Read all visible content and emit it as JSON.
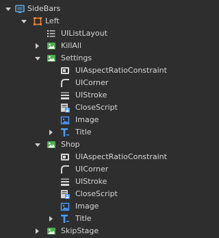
{
  "explorer": {
    "items": [
      {
        "label": "SideBars",
        "icon": "screen-gui-icon",
        "arrow": "expanded"
      },
      {
        "label": "Left",
        "icon": "frame-icon",
        "arrow": "expanded"
      },
      {
        "label": "UIListLayout",
        "icon": "list-layout-icon",
        "arrow": "none"
      },
      {
        "label": "KillAll",
        "icon": "image-button-icon",
        "arrow": "collapsed"
      },
      {
        "label": "Settings",
        "icon": "image-button-icon",
        "arrow": "expanded"
      },
      {
        "label": "UIAspectRatioConstraint",
        "icon": "aspect-ratio-icon",
        "arrow": "none"
      },
      {
        "label": "UICorner",
        "icon": "corner-icon",
        "arrow": "none"
      },
      {
        "label": "UIStroke",
        "icon": "stroke-icon",
        "arrow": "none"
      },
      {
        "label": "CloseScript",
        "icon": "local-script-icon",
        "arrow": "none"
      },
      {
        "label": "Image",
        "icon": "image-label-icon",
        "arrow": "none"
      },
      {
        "label": "Title",
        "icon": "text-label-icon",
        "arrow": "collapsed"
      },
      {
        "label": "Shop",
        "icon": "image-button-icon",
        "arrow": "expanded"
      },
      {
        "label": "UIAspectRatioConstraint",
        "icon": "aspect-ratio-icon",
        "arrow": "none"
      },
      {
        "label": "UICorner",
        "icon": "corner-icon",
        "arrow": "none"
      },
      {
        "label": "UIStroke",
        "icon": "stroke-icon",
        "arrow": "none"
      },
      {
        "label": "CloseScript",
        "icon": "local-script-icon",
        "arrow": "none"
      },
      {
        "label": "Image",
        "icon": "image-label-icon",
        "arrow": "none"
      },
      {
        "label": "Title",
        "icon": "text-label-icon",
        "arrow": "collapsed"
      },
      {
        "label": "SkipStage",
        "icon": "image-button-icon",
        "arrow": "collapsed"
      }
    ]
  },
  "colors": {
    "background": "#2e2e2e",
    "text": "#d6d6d6",
    "frame_orange": "#e8823a",
    "image_green": "#4caf50",
    "script_blue": "#4a9cff",
    "screen_blue": "#5aa9e6"
  }
}
